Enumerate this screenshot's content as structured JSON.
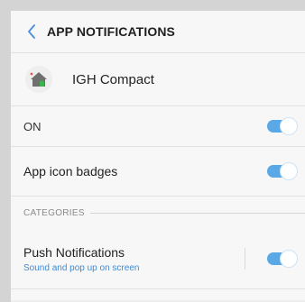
{
  "header": {
    "title": "APP NOTIFICATIONS",
    "back_icon": "chevron-left-icon"
  },
  "app": {
    "name": "IGH Compact",
    "icon": "house-icon"
  },
  "settings": {
    "on": {
      "label": "ON",
      "enabled": true
    },
    "app_icon_badges": {
      "label": "App icon badges",
      "enabled": true
    }
  },
  "categories": {
    "section_label": "CATEGORIES",
    "items": [
      {
        "title": "Push Notifications",
        "subtitle": "Sound and pop up on screen",
        "enabled": true
      }
    ]
  },
  "colors": {
    "accent": "#5aa9e6",
    "subtitle": "#3d8bd6",
    "background": "#f7f7f7"
  }
}
